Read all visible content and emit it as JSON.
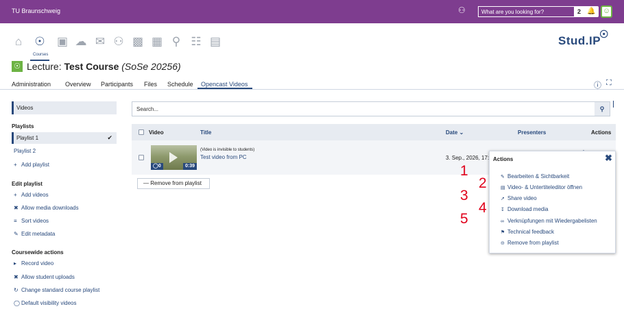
{
  "topbar": {
    "brand": "TU Braunschweig",
    "search_placeholder": "What are you looking for?",
    "notification_count": "2"
  },
  "nav": {
    "active_label": "Courses"
  },
  "logo": {
    "text": "Stud.IP"
  },
  "course": {
    "prefix": "Lecture: ",
    "name": "Test Course",
    "semester": "(SoSe 20256)"
  },
  "tabs": [
    "Administration",
    "Overview",
    "Participants",
    "Files",
    "Schedule",
    "Opencast Videos"
  ],
  "sidebar": {
    "videos": "Videos",
    "playlists_heading": "Playlists",
    "playlists": [
      "Playlist 1",
      "Playlist 2"
    ],
    "add_playlist": "Add playlist",
    "edit_heading": "Edit playlist",
    "edit_items": [
      "Add videos",
      "Allow media downloads",
      "Sort videos",
      "Edit metadata"
    ],
    "coursewide_heading": "Coursewide actions",
    "coursewide_items": [
      "Record video",
      "Allow student uploads",
      "Change standard course playlist",
      "Default visibility videos"
    ]
  },
  "main": {
    "search_placeholder": "Search...",
    "columns": {
      "video": "Video",
      "title": "Title",
      "date": "Date",
      "presenters": "Presenters",
      "actions": "Actions"
    },
    "row": {
      "views": "0",
      "duration": "0:39",
      "note": "(Video is invisible to students)",
      "title": "Test video from PC",
      "date": "3. Sep., 2026, 17:00"
    },
    "remove_button": "Remove from playlist"
  },
  "popup": {
    "title": "Actions",
    "items": [
      "Bearbeiten & Sichtbarkeit",
      "Video- & Untertiteleditor öffnen",
      "Share video",
      "Download media",
      "Verknüpfungen mit Wiedergabelisten",
      "Technical feedback",
      "Remove from playlist"
    ]
  },
  "annotations": [
    "1",
    "2",
    "3",
    "4",
    "5"
  ],
  "colors": {
    "topbar": "#7e3d8f",
    "primary": "#28497c",
    "accent_green": "#6db344",
    "annotation_red": "#e0001b"
  }
}
